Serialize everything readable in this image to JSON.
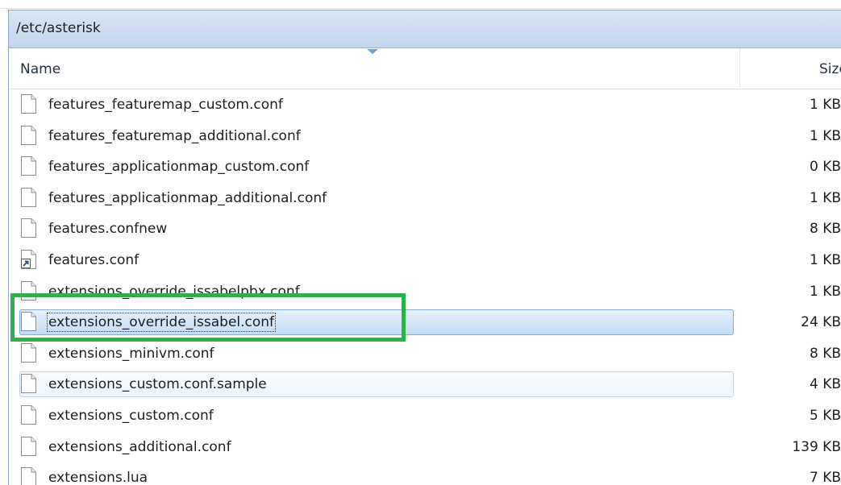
{
  "path_bar": {
    "path": "/etc/asterisk"
  },
  "columns": {
    "name": "Name",
    "size": "Size"
  },
  "files": [
    {
      "name": "features_featuremap_custom.conf",
      "size": "1 KB",
      "icon": "file-icon",
      "state": "normal"
    },
    {
      "name": "features_featuremap_additional.conf",
      "size": "1 KB",
      "icon": "file-icon",
      "state": "normal"
    },
    {
      "name": "features_applicationmap_custom.conf",
      "size": "0 KB",
      "icon": "file-icon",
      "state": "normal"
    },
    {
      "name": "features_applicationmap_additional.conf",
      "size": "1 KB",
      "icon": "file-icon",
      "state": "normal"
    },
    {
      "name": "features.confnew",
      "size": "8 KB",
      "icon": "file-icon",
      "state": "normal"
    },
    {
      "name": "features.conf",
      "size": "1 KB",
      "icon": "shortcut-file-icon",
      "state": "normal"
    },
    {
      "name": "extensions_override_issabelpbx.conf",
      "size": "1 KB",
      "icon": "file-icon",
      "state": "normal"
    },
    {
      "name": "extensions_override_issabel.conf",
      "size": "24 KB",
      "icon": "file-icon",
      "state": "selected"
    },
    {
      "name": "extensions_minivm.conf",
      "size": "8 KB",
      "icon": "file-icon",
      "state": "normal"
    },
    {
      "name": "extensions_custom.conf.sample",
      "size": "4 KB",
      "icon": "file-icon",
      "state": "hover"
    },
    {
      "name": "extensions_custom.conf",
      "size": "5 KB",
      "icon": "file-icon",
      "state": "normal"
    },
    {
      "name": "extensions_additional.conf",
      "size": "139 KB",
      "icon": "file-icon",
      "state": "normal"
    },
    {
      "name": "extensions.lua",
      "size": "7 KB",
      "icon": "file-icon",
      "state": "normal"
    }
  ],
  "colors": {
    "highlight_box": "#2fb04a",
    "selected_row": "#c5dcf7",
    "hover_row": "#ebf4fe",
    "path_bar": "#c3d5ec"
  }
}
